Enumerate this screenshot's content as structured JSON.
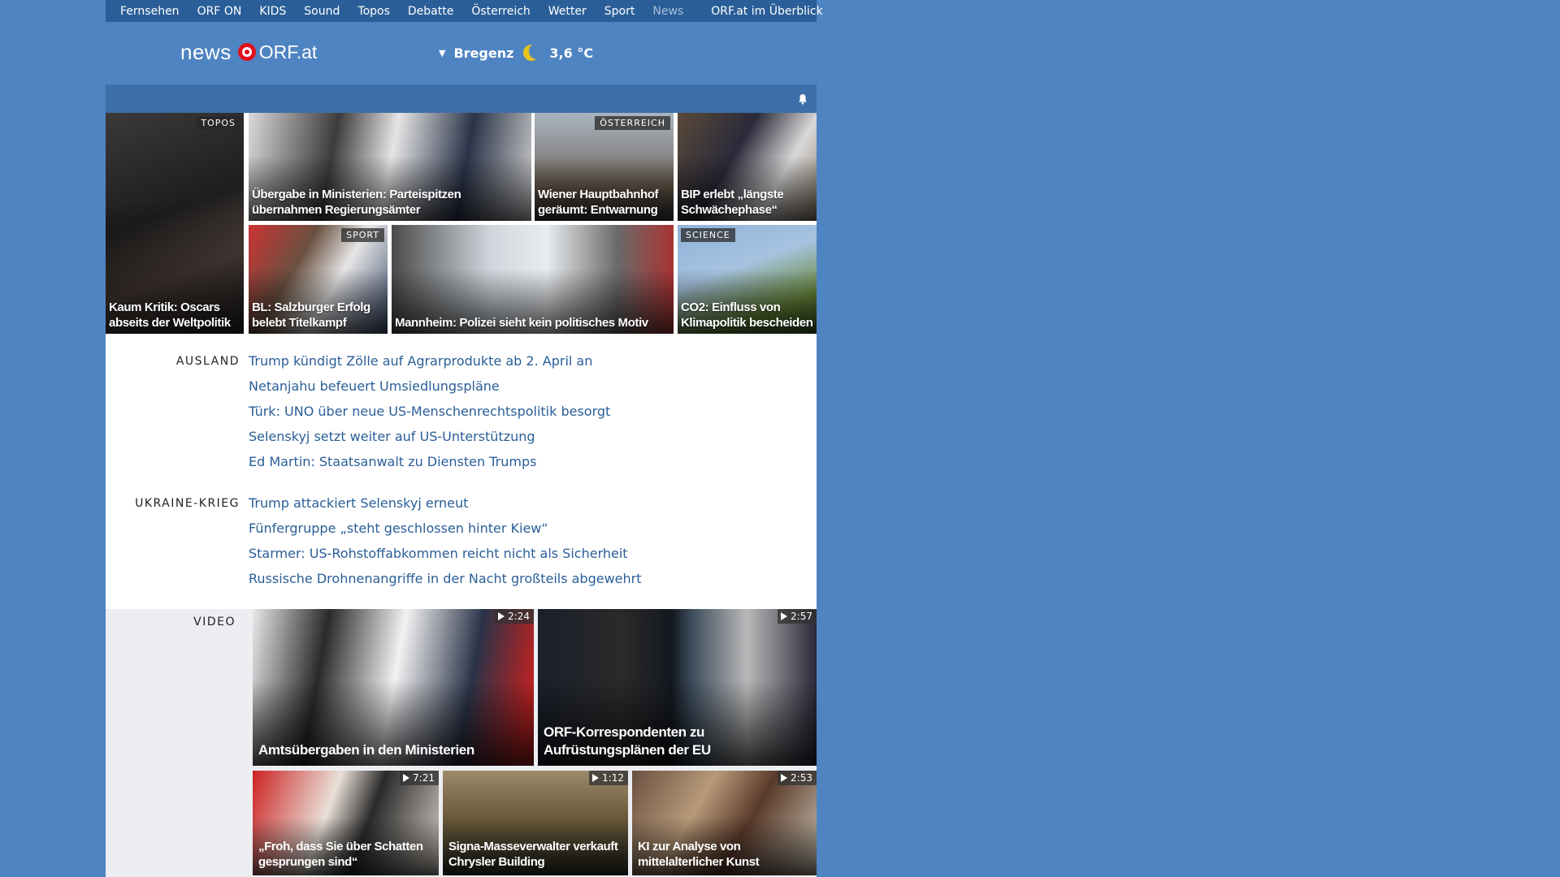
{
  "nav": {
    "items": [
      "Fernsehen",
      "ORF ON",
      "KIDS",
      "Sound",
      "Topos",
      "Debatte",
      "Österreich",
      "Wetter",
      "Sport",
      "News"
    ],
    "current": "News",
    "overview": "ORF.at im Überblick"
  },
  "header": {
    "logo_news": "news",
    "logo_orf": "ORF.at",
    "weather_city": "Bregenz",
    "weather_temp": "3,6 °C"
  },
  "grid": {
    "tiles": [
      {
        "caption": "Kaum Kritik: Oscars abseits der Weltpolitik",
        "tag": "TOPOS"
      },
      {
        "caption": "Übergabe in Ministerien: Parteispitzen übernahmen Regierungsämter",
        "tag": ""
      },
      {
        "caption": "Wiener Hauptbahnhof geräumt: Entwarnung",
        "tag": "ÖSTERREICH"
      },
      {
        "caption": "BIP erlebt „längste Schwächephase“",
        "tag": ""
      },
      {
        "caption": "BL: Salzburger Erfolg belebt Titelkampf",
        "tag": "SPORT"
      },
      {
        "caption": "Mannheim: Polizei sieht kein politisches Motiv",
        "tag": ""
      },
      {
        "caption": "CO2: Einfluss von Klimapolitik bescheiden",
        "tag": "SCIENCE"
      }
    ]
  },
  "sections": [
    {
      "label": "AUSLAND",
      "links": [
        "Trump kündigt Zölle auf Agrarprodukte ab 2. April an",
        "Netanjahu befeuert Umsiedlungspläne",
        "Türk: UNO über neue US-Menschenrechtspolitik besorgt",
        "Selenskyj setzt weiter auf US-Unterstützung",
        "Ed Martin: Staatsanwalt zu Diensten Trumps"
      ]
    },
    {
      "label": "UKRAINE-KRIEG",
      "links": [
        "Trump attackiert Selenskyj erneut",
        "Fünfergruppe „steht geschlossen hinter Kiew“",
        "Starmer: US-Rohstoffabkommen reicht nicht als Sicherheit",
        "Russische Drohnenangriffe in der Nacht großteils abgewehrt"
      ]
    }
  ],
  "video": {
    "label": "VIDEO",
    "tiles": [
      {
        "caption": "Amtsübergaben in den Ministerien",
        "duration": "2:24"
      },
      {
        "caption": "ORF-Korrespondenten zu Aufrüstungsplänen der EU",
        "duration": "2:57"
      },
      {
        "caption": "„Froh, dass Sie über Schatten gesprungen sind“",
        "duration": "7:21"
      },
      {
        "caption": "Signa-Masseverwalter verkauft Chrysler Building",
        "duration": "1:12"
      },
      {
        "caption": "KI zur Analyse von mittelalterlicher Kunst",
        "duration": "2:53"
      }
    ]
  },
  "colors": {
    "background": "#4f84c2",
    "nav_bg": "#2a5e98",
    "link": "#2a5e98",
    "orf_red": "#e0101d"
  }
}
